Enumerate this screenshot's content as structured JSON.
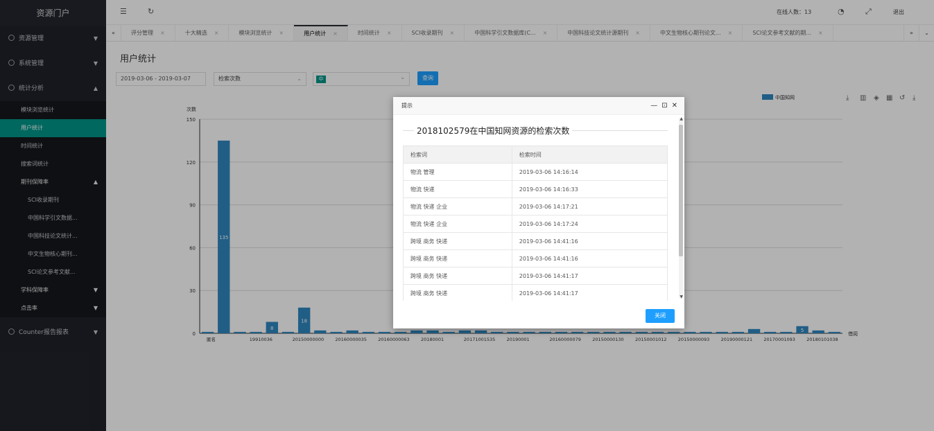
{
  "sidebar": {
    "logo": "资源门户",
    "groups": [
      {
        "label": "资源管理"
      },
      {
        "label": "系统管理"
      },
      {
        "label": "统计分析"
      }
    ],
    "stats_items": [
      "模块浏览统计",
      "用户统计",
      "时间统计",
      "搜索词统计",
      "期刊保障率"
    ],
    "journal_items": [
      "SCI收录期刊",
      "中国科学引文数据...",
      "中国科技论文统计...",
      "中文生物核心期刊...",
      "SCI论文参考文献..."
    ],
    "more_items": [
      "学科保障率",
      "点击率"
    ],
    "counter_group": "Counter报告报表"
  },
  "header": {
    "online_label": "在线人数：13",
    "logout": "退出"
  },
  "tabs": [
    "评分管理",
    "十大精选",
    "模块浏览统计",
    "用户统计",
    "时间统计",
    "SCI收录期刊",
    "中国科学引文数据库(C...",
    "中国科技论文统计源期刊",
    "中文生物核心期刊论文...",
    "SCI论文参考文献的期..."
  ],
  "active_tab_index": 3,
  "page": {
    "title": "用户统计",
    "date_range": "2019-03-06 - 2019-03-07",
    "metric_select": "检索次数",
    "resource_tag": "中",
    "query_button": "查询"
  },
  "chart_data": {
    "type": "bar",
    "ylabel": "次数",
    "xlabel": "借阅",
    "ylim": [
      0,
      150
    ],
    "yticks": [
      0,
      30,
      60,
      90,
      120,
      150
    ],
    "legend": "中国知网",
    "legend_position": "top-right",
    "x_tick_labels": [
      "匿名",
      "19910036",
      "20150000000",
      "20160000035",
      "20160000063",
      "20180001",
      "20171001535",
      "20190001",
      "20160000079",
      "20150000130",
      "20150001012",
      "20150000093",
      "20190000121",
      "20170001093",
      "20180101038"
    ],
    "values": [
      1,
      135,
      1,
      1,
      8,
      1,
      18,
      2,
      1,
      2,
      1,
      1,
      1,
      2,
      2,
      1,
      2,
      2,
      1,
      1,
      1,
      1,
      1,
      1,
      1,
      1,
      1,
      1,
      1,
      1,
      1,
      1,
      1,
      1,
      3,
      1,
      1,
      5,
      2,
      1
    ],
    "data_labels": {
      "1": "135",
      "4": "8",
      "6": "18",
      "37": "5"
    }
  },
  "modal": {
    "header": "提示",
    "title": "2018102579在中国知网资源的检索次数",
    "columns": [
      "检索词",
      "检索时间"
    ],
    "rows": [
      [
        "物流 管理",
        "2019-03-06 14:16:14"
      ],
      [
        "物流 快递",
        "2019-03-06 14:16:33"
      ],
      [
        "物流 快递 企业",
        "2019-03-06 14:17:21"
      ],
      [
        "物流 快递 企业",
        "2019-03-06 14:17:24"
      ],
      [
        "跨境 商务 快递",
        "2019-03-06 14:41:16"
      ],
      [
        "跨境 商务 快递",
        "2019-03-06 14:41:16"
      ],
      [
        "跨境 商务 快递",
        "2019-03-06 14:41:17"
      ],
      [
        "跨境 商务 快递",
        "2019-03-06 14:41:17"
      ]
    ],
    "close_button": "关闭"
  }
}
